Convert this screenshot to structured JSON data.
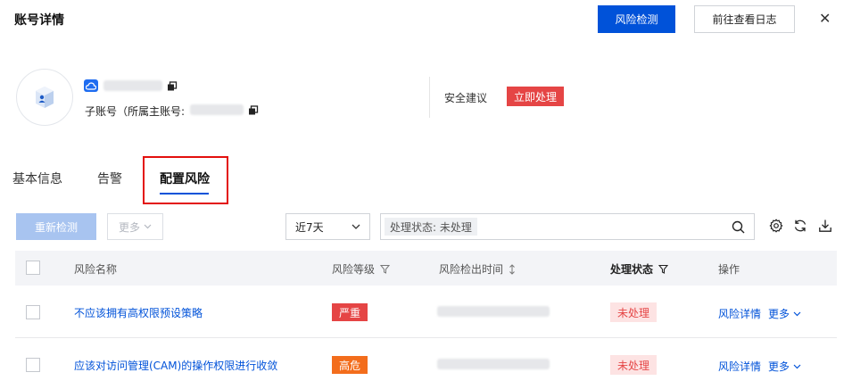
{
  "header": {
    "title": "账号详情",
    "risk_check_button": "风险检测",
    "view_log_button": "前往查看日志",
    "close_label": "✕"
  },
  "account": {
    "sub_account_label": "子账号（所属主账号:",
    "security_advice_label": "安全建议",
    "security_action": "立即处理"
  },
  "tabs": [
    {
      "label": "基本信息"
    },
    {
      "label": "告警"
    },
    {
      "label": "配置风险"
    }
  ],
  "toolbar": {
    "recheck_button": "重新检测",
    "more_button": "更多",
    "time_range": "近7天",
    "filter_tag": "处理状态: 未处理"
  },
  "table": {
    "columns": {
      "name": "风险名称",
      "level": "风险等级",
      "detected_time": "风险检出时间",
      "status": "处理状态",
      "actions": "操作"
    },
    "rows": [
      {
        "name": "不应该拥有高权限预设策略",
        "level": "严重",
        "status": "未处理",
        "detail": "风险详情",
        "more": "更多"
      },
      {
        "name": "应该对访问管理(CAM)的操作权限进行收敛",
        "level": "高危",
        "status": "未处理",
        "detail": "风险详情",
        "more": "更多"
      }
    ]
  },
  "colors": {
    "primary": "#0052d9",
    "critical": "#e54545",
    "high": "#f36d1c",
    "highlight_frame": "#e3100d"
  }
}
